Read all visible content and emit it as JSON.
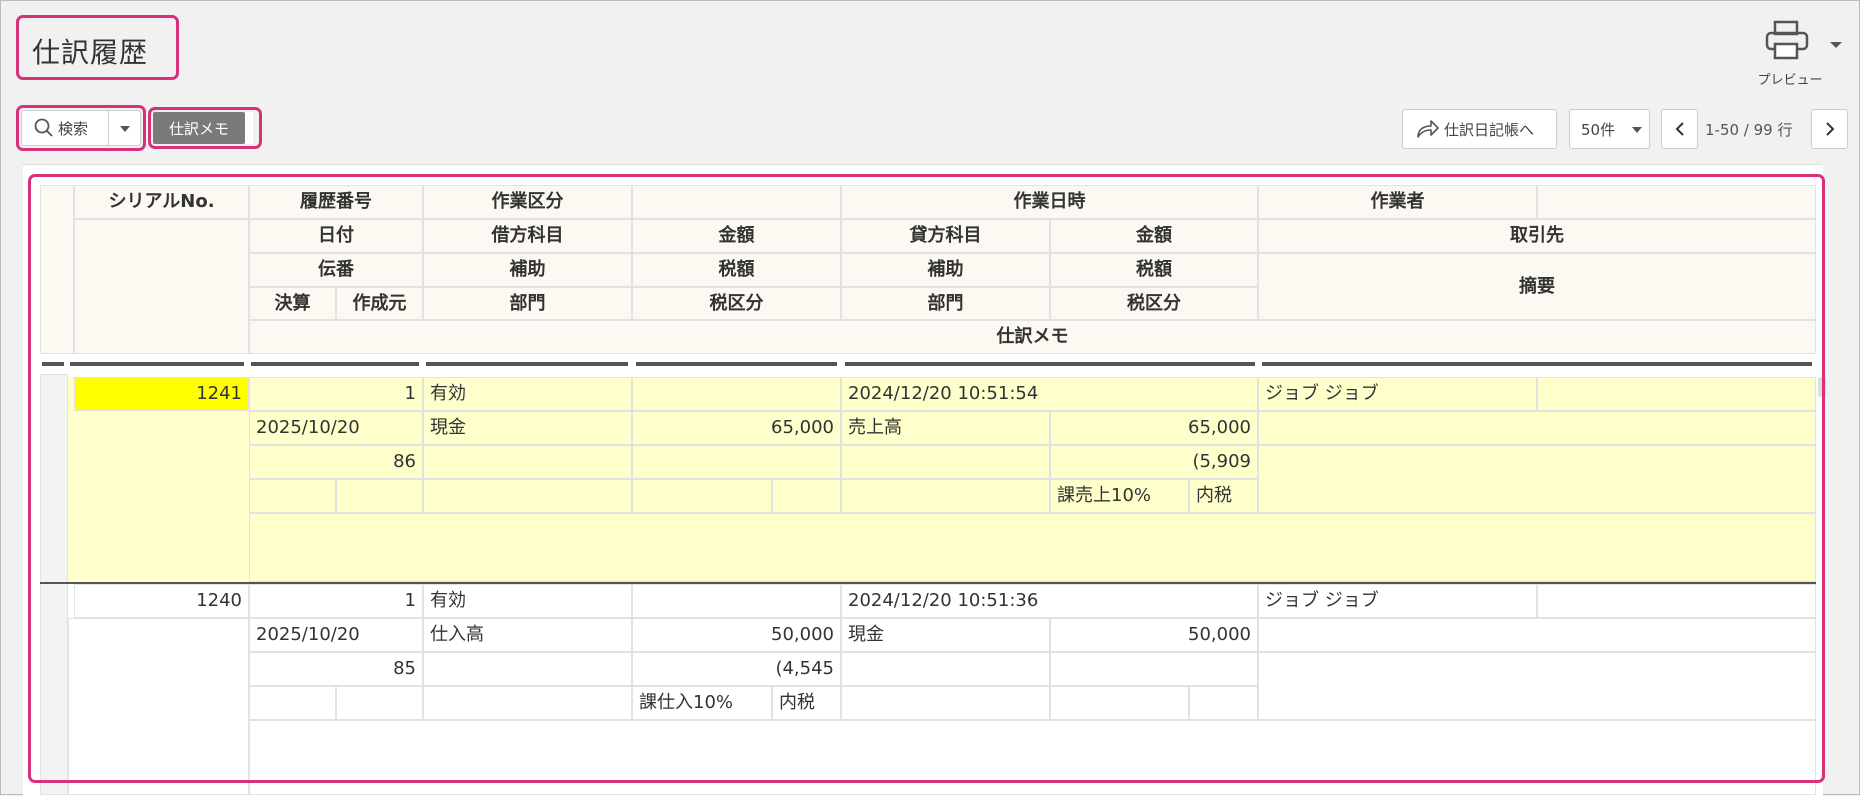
{
  "page": {
    "title": "仕訳履歴"
  },
  "toolbar": {
    "print_label": "プレビュー",
    "search_label": "検索",
    "memo_label": "仕訳メモ",
    "journal_link_label": "仕訳日記帳へ",
    "per_page": "50件",
    "pagination": "1-50 / 99 行"
  },
  "header": {
    "row1": [
      "シリアルNo.",
      "履歴番号",
      "作業区分",
      "作業日時",
      "作業者"
    ],
    "row2": [
      "日付",
      "借方科目",
      "金額",
      "貸方科目",
      "金額",
      "取引先"
    ],
    "row3": [
      "伝番",
      "補助",
      "税額",
      "補助",
      "税額",
      "摘要"
    ],
    "row4": [
      "決算",
      "作成元",
      "部門",
      "税区分",
      "部門",
      "税区分"
    ],
    "row5": "仕訳メモ"
  },
  "records": [
    {
      "serial": "1241",
      "history_no": "1",
      "work_type": "有効",
      "work_datetime": "2024/12/20 10:51:54",
      "worker": "ジョブ ジョブ",
      "date": "2025/10/20",
      "debit_account": "現金",
      "debit_amount": "65,000",
      "credit_account": "売上高",
      "credit_amount": "65,000",
      "voucher_no": "86",
      "debit_tax": "",
      "credit_tax": "(5,909",
      "debit_tax_class": "",
      "debit_tax_mode": "",
      "credit_tax_class": "課売上10%",
      "credit_tax_mode": "内税"
    },
    {
      "serial": "1240",
      "history_no": "1",
      "work_type": "有効",
      "work_datetime": "2024/12/20 10:51:36",
      "worker": "ジョブ ジョブ",
      "date": "2025/10/20",
      "debit_account": "仕入高",
      "debit_amount": "50,000",
      "credit_account": "現金",
      "credit_amount": "50,000",
      "voucher_no": "85",
      "debit_tax": "(4,545",
      "credit_tax": "",
      "debit_tax_class": "課仕入10%",
      "debit_tax_mode": "内税",
      "credit_tax_class": "",
      "credit_tax_mode": ""
    }
  ],
  "colors": {
    "accent": "#d6317a",
    "selected_row": "#ffffcc",
    "serial_highlight": "#ffff00",
    "memo_button": "#7a7a7a"
  },
  "icons": [
    "printer-icon",
    "search-icon",
    "share-arrow-icon",
    "chevron-left-icon",
    "chevron-right-icon"
  ]
}
